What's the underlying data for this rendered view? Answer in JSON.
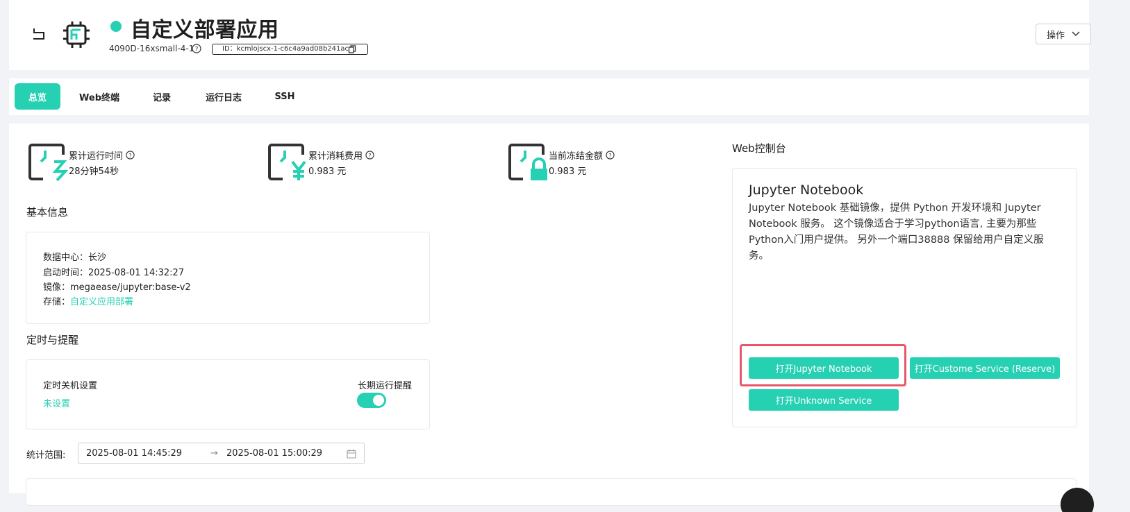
{
  "header": {
    "title": "自定义部署应用",
    "instance_spec": "4090D-16xsmall-4-1",
    "id_text": "ID：kcmlojscx-1-c6c4a9ad08b241ac",
    "operation_label": "操作",
    "status_color": "#26d0b3"
  },
  "tabs": [
    {
      "label": "总览",
      "active": true
    },
    {
      "label": "Web终端",
      "active": false
    },
    {
      "label": "记录",
      "active": false
    },
    {
      "label": "运行日志",
      "active": false
    },
    {
      "label": "SSH",
      "active": false
    }
  ],
  "stats": [
    {
      "label": "累计运行时间",
      "value": "28分钟54秒",
      "icon": "runtime-icon"
    },
    {
      "label": "累计消耗费用",
      "value": "0.983 元",
      "icon": "cost-icon"
    },
    {
      "label": "当前冻结金额",
      "value": "0.983 元",
      "icon": "frozen-icon"
    }
  ],
  "basic_info": {
    "title": "基本信息",
    "datacenter_label": "数据中心：",
    "datacenter_value": "长沙",
    "start_label": "启动时间：",
    "start_value": "2025-08-01 14:32:27",
    "image_label": "镜像：",
    "image_value": "megaease/jupyter:base-v2",
    "storage_label": "存储：",
    "storage_value": "自定义应用部署"
  },
  "schedule": {
    "title": "定时与提醒",
    "shutdown_label": "定时关机设置",
    "shutdown_value": "未设置",
    "reminder_label": "长期运行提醒",
    "reminder_on": true
  },
  "stat_range": {
    "label": "统计范围:",
    "start": "2025-08-01 14:45:29",
    "arrow": "→",
    "end": "2025-08-01 15:00:29"
  },
  "web_console": {
    "title": "Web控制台",
    "app_name": "Jupyter Notebook",
    "description": "Jupyter Notebook 基础镜像，提供 Python 开发环境和 Jupyter Notebook 服务。 这个镜像适合于学习python语言, 主要为那些Python入门用户提供。 另外一个端口38888 保留给用户自定义服务。",
    "buttons": [
      "打开Jupyter Notebook",
      "打开Custome Service (Reserve)",
      "打开Unknown Service"
    ]
  },
  "colors": {
    "accent": "#26d0b3",
    "highlight": "#e8566b"
  }
}
